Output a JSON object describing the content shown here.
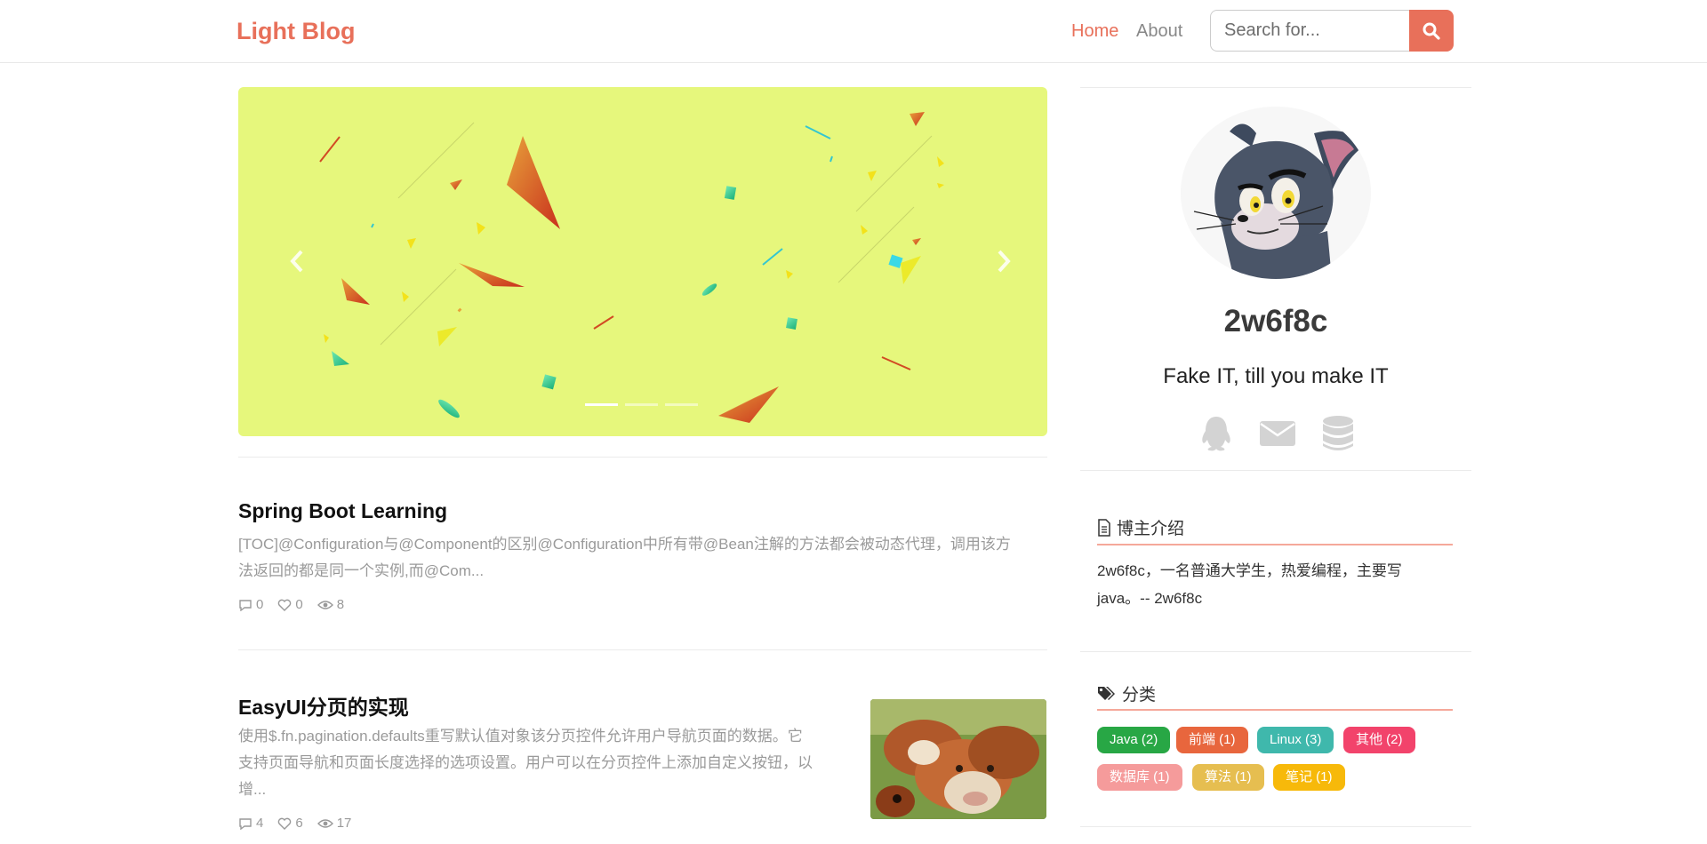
{
  "navbar": {
    "brand": "Light Blog",
    "links": [
      {
        "label": "Home",
        "active": true
      },
      {
        "label": "About",
        "active": false
      }
    ],
    "search_placeholder": "Search for...",
    "accent": "#e8705a"
  },
  "carousel": {
    "background": "#e6f77c",
    "slides": 3,
    "active_slide": 1
  },
  "posts": [
    {
      "title": "Spring Boot Learning",
      "excerpt_line1": "[TOC]@Configuration与@Component的区别@Configuration中所有带@Bean注解的方法都会被动态代理，调用该方",
      "excerpt_line2": "法返回的都是同一个实例,而@Com...",
      "comments": "0",
      "likes": "0",
      "views": "8"
    },
    {
      "title": "EasyUI分页的实现",
      "excerpt_line1": "使用$.fn.pagination.defaults重写默认值对象该分页控件允许用户导航页面的数据。它",
      "excerpt_line2": "支持页面导航和页面长度选择的选项设置。用户可以在分页控件上添加自定义按钮，以",
      "excerpt_line3": "增...",
      "comments": "4",
      "likes": "6",
      "views": "17",
      "thumbnail": "cows-photo"
    }
  ],
  "profile": {
    "name": "2w6f8c",
    "motto": "Fake IT, till you make IT",
    "social_icons": [
      "qq-icon",
      "mail-icon",
      "database-icon"
    ]
  },
  "about": {
    "title": "博主介绍",
    "text_line1": "2w6f8c，一名普通大学生，热爱编程，主要写",
    "text_line2": "java。-- 2w6f8c"
  },
  "categories": {
    "title": "分类",
    "tags": [
      {
        "label": "Java (2)",
        "color": "#28a745"
      },
      {
        "label": "前端 (1)",
        "color": "#e8663d"
      },
      {
        "label": "Linux (3)",
        "color": "#3fb8ac"
      },
      {
        "label": "其他 (2)",
        "color": "#f2436b"
      },
      {
        "label": "数据库 (1)",
        "color": "#f59b9b"
      },
      {
        "label": "算法 (1)",
        "color": "#e6be50"
      },
      {
        "label": "笔记 (1)",
        "color": "#f7b90a"
      }
    ]
  }
}
